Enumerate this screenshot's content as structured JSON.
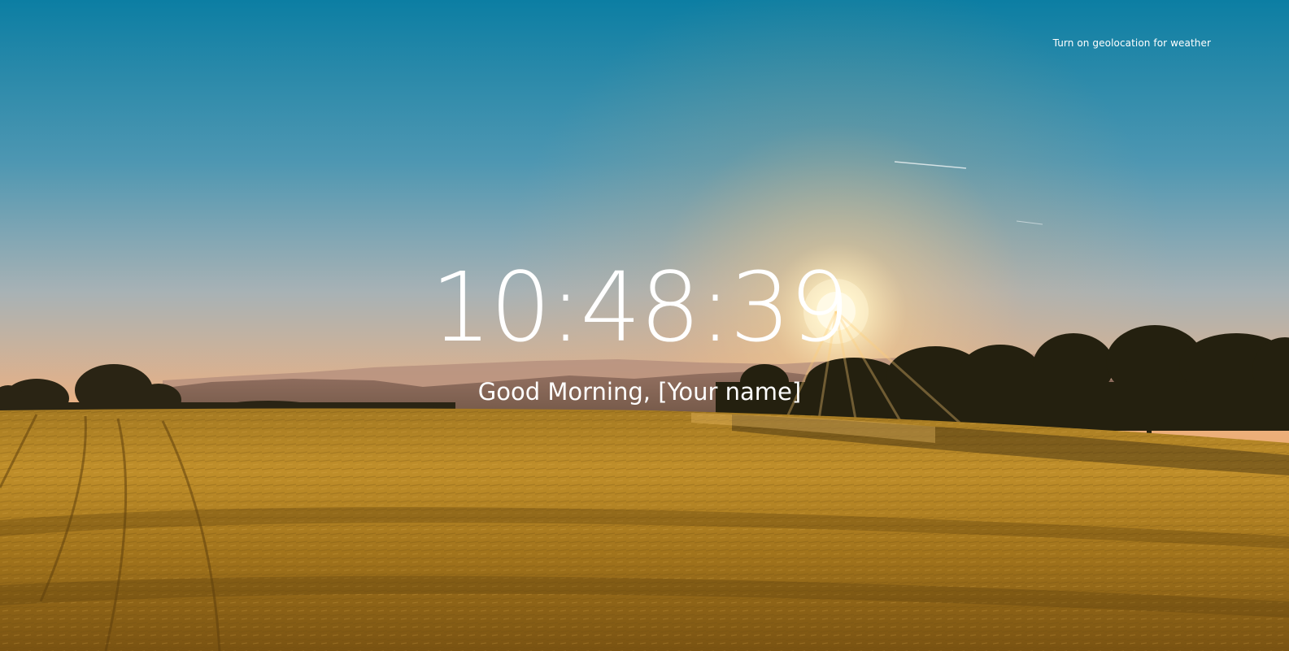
{
  "weather": {
    "prompt": "Turn on geolocation for weather"
  },
  "clock": {
    "time": "10:48:39"
  },
  "greeting": {
    "text": "Good Morning, [Your name]"
  },
  "background": {
    "description_colors": {
      "sky_top": "#0f7fa4",
      "sky_mid": "#8fb0bf",
      "horizon": "#f3b173",
      "sun": "#fff6d8",
      "field": "#b8841f",
      "field_dark": "#6f4d10",
      "trees": "#1f1d12"
    }
  }
}
